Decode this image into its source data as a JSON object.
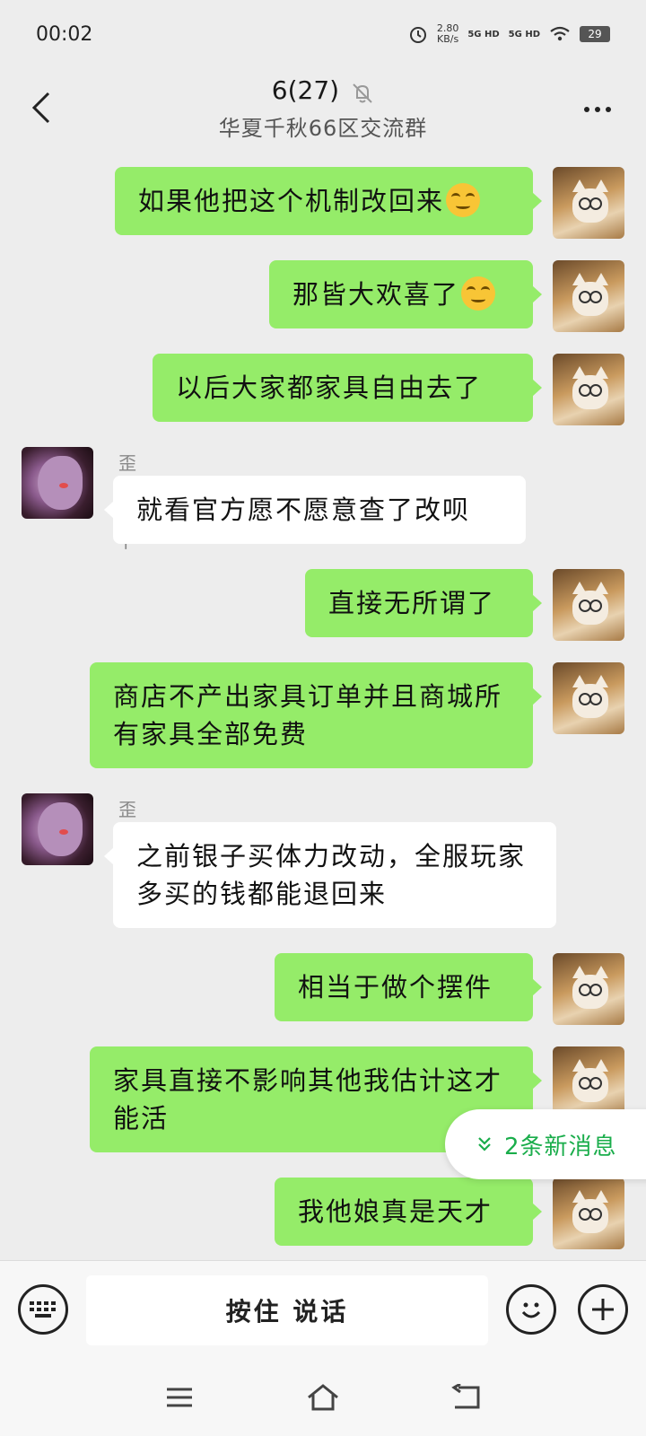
{
  "status": {
    "time": "00:02",
    "speed_value": "2.80",
    "speed_unit": "KB/s",
    "network1": "5G HD",
    "network2": "5G HD",
    "battery": "29"
  },
  "header": {
    "title": "6(27)",
    "subtitle": "华夏千秋66区交流群"
  },
  "messages": [
    {
      "side": "me",
      "text": "如果他把这个机制改回来",
      "emoji": "smirk-emoji"
    },
    {
      "side": "me",
      "text": "那皆大欢喜了",
      "emoji": "smirk-emoji"
    },
    {
      "side": "me",
      "text": "以后大家都家具自由去了"
    },
    {
      "side": "other",
      "sender": "歪比巴卜",
      "text": "就看官方愿不愿意查了改呗"
    },
    {
      "side": "me",
      "text": "直接无所谓了"
    },
    {
      "side": "me",
      "text": "商店不产出家具订单并且商城所有家具全部免费"
    },
    {
      "side": "other",
      "sender": "歪比巴卜",
      "text": "之前银子买体力改动，全服玩家多买的钱都能退回来"
    },
    {
      "side": "me",
      "text": "相当于做个摆件"
    },
    {
      "side": "me",
      "text": "家具直接不影响其他我估计这才能活"
    },
    {
      "side": "me",
      "text": "我他娘真是天才"
    }
  ],
  "new_messages": {
    "label": "2条新消息"
  },
  "input": {
    "talk_label": "按住 说话"
  },
  "colors": {
    "me_bubble": "#95ec69",
    "other_bubble": "#ffffff",
    "background": "#ededed",
    "accent": "#1aad4b"
  }
}
